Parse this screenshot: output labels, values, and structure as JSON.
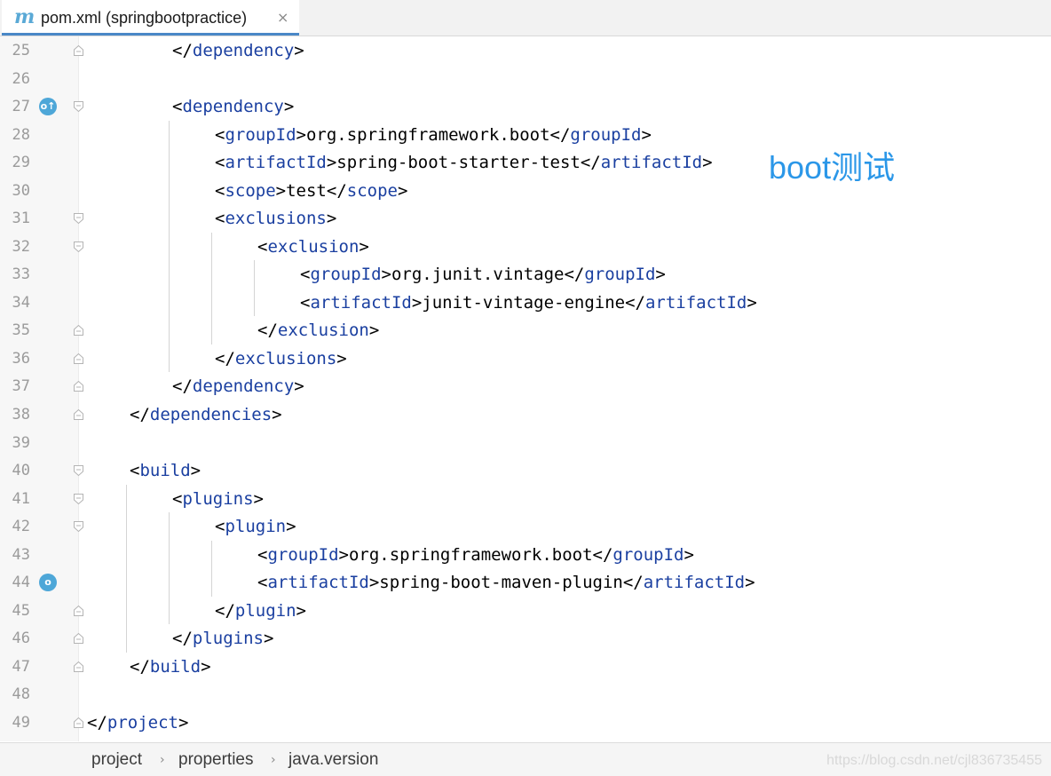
{
  "tab": {
    "icon": "m",
    "icon_name": "maven-icon",
    "label": "pom.xml (springbootpractice)",
    "close": "×"
  },
  "lines": [
    {
      "num": "25",
      "indent": 2,
      "segments": [
        [
          "br",
          "</"
        ],
        [
          "tag",
          "dependency"
        ],
        [
          "br",
          ">"
        ]
      ],
      "fold": "end"
    },
    {
      "num": "26",
      "indent": 0,
      "segments": []
    },
    {
      "num": "27",
      "indent": 2,
      "segments": [
        [
          "br",
          "<"
        ],
        [
          "tag",
          "dependency"
        ],
        [
          "br",
          ">"
        ]
      ],
      "fold": "start",
      "gutter_icon": "o↑"
    },
    {
      "num": "28",
      "indent": 3,
      "segments": [
        [
          "br",
          "<"
        ],
        [
          "tag",
          "groupId"
        ],
        [
          "br",
          ">"
        ],
        [
          "txt",
          "org.springframework.boot"
        ],
        [
          "br",
          "</"
        ],
        [
          "tag",
          "groupId"
        ],
        [
          "br",
          ">"
        ]
      ]
    },
    {
      "num": "29",
      "indent": 3,
      "segments": [
        [
          "br",
          "<"
        ],
        [
          "tag",
          "artifactId"
        ],
        [
          "br",
          ">"
        ],
        [
          "txt",
          "spring-boot-starter-test"
        ],
        [
          "br",
          "</"
        ],
        [
          "tag",
          "artifactId"
        ],
        [
          "br",
          ">"
        ]
      ]
    },
    {
      "num": "30",
      "indent": 3,
      "segments": [
        [
          "br",
          "<"
        ],
        [
          "tag",
          "scope"
        ],
        [
          "br",
          ">"
        ],
        [
          "txt",
          "test"
        ],
        [
          "br",
          "</"
        ],
        [
          "tag",
          "scope"
        ],
        [
          "br",
          ">"
        ]
      ]
    },
    {
      "num": "31",
      "indent": 3,
      "segments": [
        [
          "br",
          "<"
        ],
        [
          "tag",
          "exclusions"
        ],
        [
          "br",
          ">"
        ]
      ],
      "fold": "start"
    },
    {
      "num": "32",
      "indent": 4,
      "segments": [
        [
          "br",
          "<"
        ],
        [
          "tag",
          "exclusion"
        ],
        [
          "br",
          ">"
        ]
      ],
      "fold": "start"
    },
    {
      "num": "33",
      "indent": 5,
      "segments": [
        [
          "br",
          "<"
        ],
        [
          "tag",
          "groupId"
        ],
        [
          "br",
          ">"
        ],
        [
          "txt",
          "org.junit.vintage"
        ],
        [
          "br",
          "</"
        ],
        [
          "tag",
          "groupId"
        ],
        [
          "br",
          ">"
        ]
      ]
    },
    {
      "num": "34",
      "indent": 5,
      "segments": [
        [
          "br",
          "<"
        ],
        [
          "tag",
          "artifactId"
        ],
        [
          "br",
          ">"
        ],
        [
          "txt",
          "junit-vintage-engine"
        ],
        [
          "br",
          "</"
        ],
        [
          "tag",
          "artifactId"
        ],
        [
          "br",
          ">"
        ]
      ]
    },
    {
      "num": "35",
      "indent": 4,
      "segments": [
        [
          "br",
          "</"
        ],
        [
          "tag",
          "exclusion"
        ],
        [
          "br",
          ">"
        ]
      ],
      "fold": "end"
    },
    {
      "num": "36",
      "indent": 3,
      "segments": [
        [
          "br",
          "</"
        ],
        [
          "tag",
          "exclusions"
        ],
        [
          "br",
          ">"
        ]
      ],
      "fold": "end"
    },
    {
      "num": "37",
      "indent": 2,
      "segments": [
        [
          "br",
          "</"
        ],
        [
          "tag",
          "dependency"
        ],
        [
          "br",
          ">"
        ]
      ],
      "fold": "end"
    },
    {
      "num": "38",
      "indent": 1,
      "segments": [
        [
          "br",
          "</"
        ],
        [
          "tag",
          "dependencies"
        ],
        [
          "br",
          ">"
        ]
      ],
      "fold": "end"
    },
    {
      "num": "39",
      "indent": 0,
      "segments": []
    },
    {
      "num": "40",
      "indent": 1,
      "segments": [
        [
          "br",
          "<"
        ],
        [
          "tag",
          "build"
        ],
        [
          "br",
          ">"
        ]
      ],
      "fold": "start"
    },
    {
      "num": "41",
      "indent": 2,
      "segments": [
        [
          "br",
          "<"
        ],
        [
          "tag",
          "plugins"
        ],
        [
          "br",
          ">"
        ]
      ],
      "fold": "start"
    },
    {
      "num": "42",
      "indent": 3,
      "segments": [
        [
          "br",
          "<"
        ],
        [
          "tag",
          "plugin"
        ],
        [
          "br",
          ">"
        ]
      ],
      "fold": "start"
    },
    {
      "num": "43",
      "indent": 4,
      "segments": [
        [
          "br",
          "<"
        ],
        [
          "tag",
          "groupId"
        ],
        [
          "br",
          ">"
        ],
        [
          "txt",
          "org.springframework.boot"
        ],
        [
          "br",
          "</"
        ],
        [
          "tag",
          "groupId"
        ],
        [
          "br",
          ">"
        ]
      ]
    },
    {
      "num": "44",
      "indent": 4,
      "segments": [
        [
          "br",
          "<"
        ],
        [
          "tag",
          "artifactId"
        ],
        [
          "br",
          ">"
        ],
        [
          "txt",
          "spring-boot-maven-plugin"
        ],
        [
          "br",
          "</"
        ],
        [
          "tag",
          "artifactId"
        ],
        [
          "br",
          ">"
        ]
      ],
      "gutter_icon": "o"
    },
    {
      "num": "45",
      "indent": 3,
      "segments": [
        [
          "br",
          "</"
        ],
        [
          "tag",
          "plugin"
        ],
        [
          "br",
          ">"
        ]
      ],
      "fold": "end"
    },
    {
      "num": "46",
      "indent": 2,
      "segments": [
        [
          "br",
          "</"
        ],
        [
          "tag",
          "plugins"
        ],
        [
          "br",
          ">"
        ]
      ],
      "fold": "end"
    },
    {
      "num": "47",
      "indent": 1,
      "segments": [
        [
          "br",
          "</"
        ],
        [
          "tag",
          "build"
        ],
        [
          "br",
          ">"
        ]
      ],
      "fold": "end"
    },
    {
      "num": "48",
      "indent": 0,
      "segments": []
    },
    {
      "num": "49",
      "indent": 0,
      "segments": [
        [
          "br",
          "</"
        ],
        [
          "tag",
          "project"
        ],
        [
          "br",
          ">"
        ]
      ],
      "fold": "end"
    }
  ],
  "annotation": "boot测试",
  "breadcrumb": {
    "items": [
      "project",
      "properties",
      "java.version"
    ],
    "separator": "›"
  },
  "watermark": "https://blog.csdn.net/cjl836735455",
  "colors": {
    "tag": "#1a3fa0",
    "text": "#000000",
    "annotation": "#2b97e8",
    "tab_underline": "#4a88c7"
  }
}
